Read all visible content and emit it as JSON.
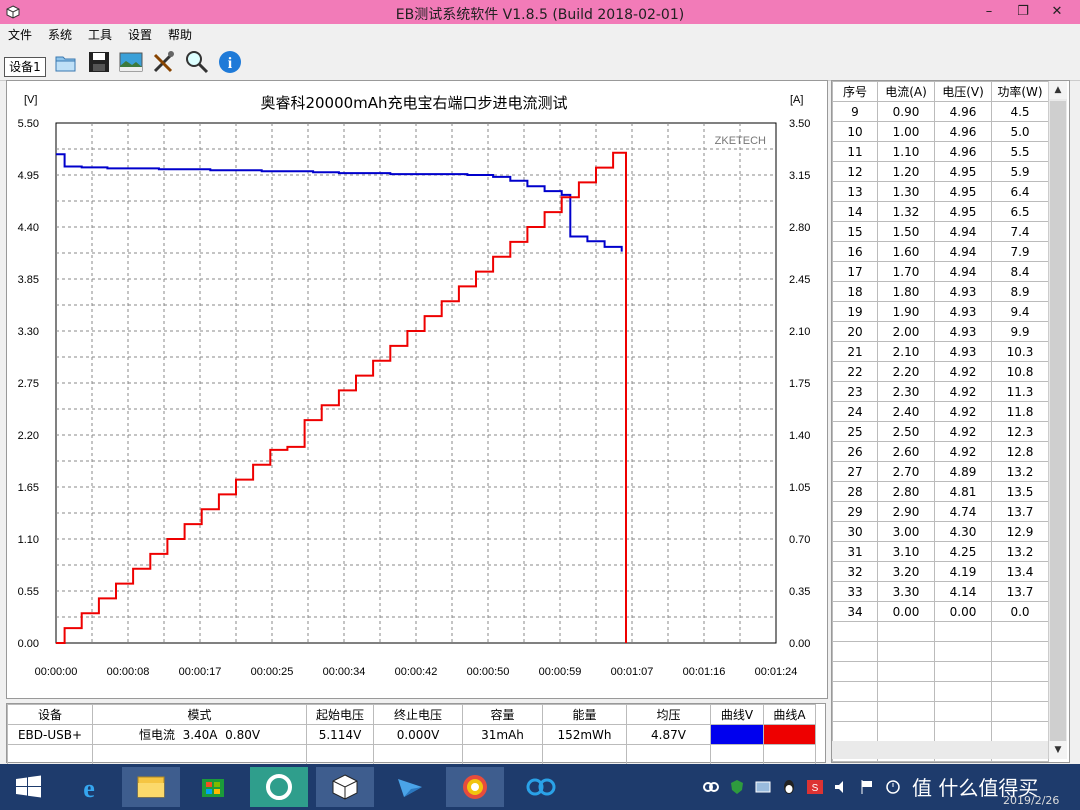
{
  "window": {
    "title": "EB测试系统软件 V1.8.5 (Build 2018-02-01)",
    "controls": [
      "–",
      "❐",
      "✕"
    ]
  },
  "menu": [
    "文件",
    "系统",
    "工具",
    "设置",
    "帮助"
  ],
  "toolbar": {
    "device_tab": "设备1",
    "buttons": [
      "open-folder-icon",
      "save-icon",
      "image-icon",
      "tools-icon",
      "magnifier-icon",
      "info-icon"
    ]
  },
  "chart_data": {
    "type": "line",
    "title": "奥睿科20000mAh充电宝右端口步进电流测试",
    "watermark": "ZKETECH",
    "ylabel_left": "[V]",
    "ylabel_right": "[A]",
    "ylim_left": [
      0,
      5.5
    ],
    "ylim_right": [
      0,
      3.5
    ],
    "xlim_seconds": [
      0,
      84
    ],
    "grid": true,
    "y_ticks_left": [
      "5.50",
      "4.95",
      "4.40",
      "3.85",
      "3.30",
      "2.75",
      "2.20",
      "1.65",
      "1.10",
      "0.55",
      "0.00"
    ],
    "y_ticks_right": [
      "3.50",
      "3.15",
      "2.80",
      "2.45",
      "2.10",
      "1.75",
      "1.40",
      "1.05",
      "0.70",
      "0.35",
      "0.00"
    ],
    "x_ticks": [
      "00:00:00",
      "00:00:08",
      "00:00:17",
      "00:00:25",
      "00:00:34",
      "00:00:42",
      "00:00:50",
      "00:00:59",
      "00:01:07",
      "00:01:16",
      "00:01:24"
    ],
    "series": [
      {
        "axis": "left",
        "color": "#0000cc",
        "x": [
          0,
          1,
          1,
          3,
          6,
          9,
          12,
          15,
          18,
          21,
          24,
          27,
          30,
          33,
          36,
          39,
          42,
          45,
          48,
          51,
          53,
          55,
          57,
          59,
          60,
          62,
          64,
          66
        ],
        "y": [
          5.17,
          5.17,
          5.04,
          5.03,
          5.02,
          5.02,
          5.01,
          5.01,
          5.0,
          5.0,
          4.99,
          4.99,
          4.98,
          4.97,
          4.97,
          4.96,
          4.96,
          4.96,
          4.95,
          4.93,
          4.89,
          4.83,
          4.78,
          4.74,
          4.3,
          4.25,
          4.19,
          4.14
        ]
      },
      {
        "axis": "right",
        "color": "#ee0000",
        "x": [
          0,
          1,
          3,
          5,
          7,
          9,
          11,
          13,
          15,
          17,
          19,
          21,
          23,
          25,
          27,
          29,
          31,
          33,
          35,
          37,
          39,
          41,
          43,
          45,
          47,
          49,
          51,
          53,
          55,
          57,
          59,
          61,
          63,
          65,
          66.4,
          66.5
        ],
        "y": [
          0.0,
          0.1,
          0.2,
          0.3,
          0.4,
          0.5,
          0.6,
          0.7,
          0.8,
          0.9,
          1.0,
          1.1,
          1.2,
          1.3,
          1.32,
          1.5,
          1.6,
          1.7,
          1.8,
          1.9,
          2.0,
          2.1,
          2.2,
          2.3,
          2.4,
          2.5,
          2.6,
          2.7,
          2.8,
          2.9,
          3.0,
          3.1,
          3.2,
          3.3,
          3.3,
          0.0
        ]
      }
    ]
  },
  "data_table": {
    "headers": [
      "序号",
      "电流(A)",
      "电压(V)",
      "功率(W)"
    ],
    "rows": [
      [
        "9",
        "0.90",
        "4.96",
        "4.5"
      ],
      [
        "10",
        "1.00",
        "4.96",
        "5.0"
      ],
      [
        "11",
        "1.10",
        "4.96",
        "5.5"
      ],
      [
        "12",
        "1.20",
        "4.95",
        "5.9"
      ],
      [
        "13",
        "1.30",
        "4.95",
        "6.4"
      ],
      [
        "14",
        "1.32",
        "4.95",
        "6.5"
      ],
      [
        "15",
        "1.50",
        "4.94",
        "7.4"
      ],
      [
        "16",
        "1.60",
        "4.94",
        "7.9"
      ],
      [
        "17",
        "1.70",
        "4.94",
        "8.4"
      ],
      [
        "18",
        "1.80",
        "4.93",
        "8.9"
      ],
      [
        "19",
        "1.90",
        "4.93",
        "9.4"
      ],
      [
        "20",
        "2.00",
        "4.93",
        "9.9"
      ],
      [
        "21",
        "2.10",
        "4.93",
        "10.3"
      ],
      [
        "22",
        "2.20",
        "4.92",
        "10.8"
      ],
      [
        "23",
        "2.30",
        "4.92",
        "11.3"
      ],
      [
        "24",
        "2.40",
        "4.92",
        "11.8"
      ],
      [
        "25",
        "2.50",
        "4.92",
        "12.3"
      ],
      [
        "26",
        "2.60",
        "4.92",
        "12.8"
      ],
      [
        "27",
        "2.70",
        "4.89",
        "13.2"
      ],
      [
        "28",
        "2.80",
        "4.81",
        "13.5"
      ],
      [
        "29",
        "2.90",
        "4.74",
        "13.7"
      ],
      [
        "30",
        "3.00",
        "4.30",
        "12.9"
      ],
      [
        "31",
        "3.10",
        "4.25",
        "13.2"
      ],
      [
        "32",
        "3.20",
        "4.19",
        "13.4"
      ],
      [
        "33",
        "3.30",
        "4.14",
        "13.7"
      ],
      [
        "34",
        "0.00",
        "0.00",
        "0.0"
      ]
    ],
    "empty_rows": 7
  },
  "status": {
    "headers": [
      "设备",
      "模式",
      "起始电压",
      "终止电压",
      "容量",
      "能量",
      "均压",
      "曲线V",
      "曲线A"
    ],
    "values": [
      "EBD-USB+",
      "恒电流  3.40A  0.80V",
      "5.114V",
      "0.000V",
      "31mAh",
      "152mWh",
      "4.87V"
    ],
    "curve_v_color": "#0000ee",
    "curve_a_color": "#ee0000"
  },
  "taskbar": {
    "apps": [
      "start-icon",
      "ie-icon",
      "explorer-icon",
      "store-icon",
      "browser-icon",
      "eb-app-icon",
      "bird-app-icon",
      "photos-icon",
      "baidu-cloud-icon"
    ],
    "tray": [
      "baidu-tray-icon",
      "shield-tray-icon",
      "network-tray-icon",
      "qq-tray-icon",
      "ime-tray-icon",
      "speaker-tray-icon",
      "flag-tray-icon",
      "clock-tray-icon"
    ],
    "watermark": "值 什么值得买",
    "date": "2019/2/26"
  }
}
